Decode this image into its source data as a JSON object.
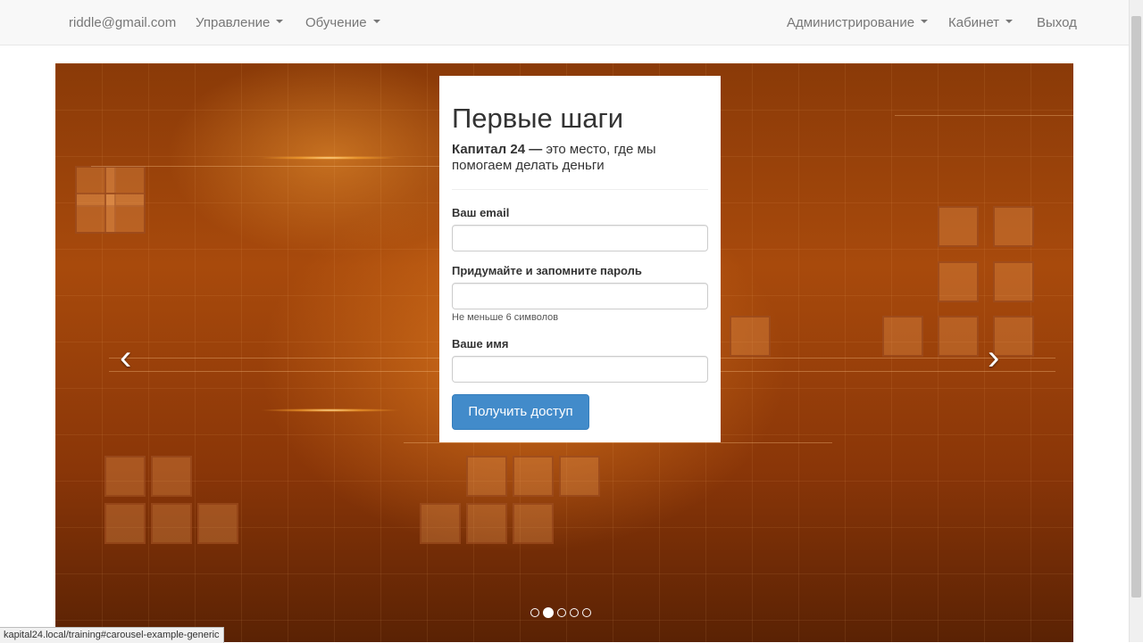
{
  "navbar": {
    "user_email": "riddle@gmail.com",
    "manage_label": "Управление",
    "training_label": "Обучение",
    "admin_label": "Администрирование",
    "cabinet_label": "Кабинет",
    "logout_label": "Выход"
  },
  "carousel": {
    "prev_icon": "‹",
    "next_icon": "›",
    "slide_count": 5,
    "active_slide": 2
  },
  "form": {
    "title": "Первые шаги",
    "lead_bold": "Капитал 24 —",
    "lead_rest": " это место, где мы помогаем делать деньги",
    "email_label": "Ваш email",
    "email_value": "",
    "password_label": "Придумайте и запомните пароль",
    "password_value": "",
    "password_help": "Не меньше 6 символов",
    "name_label": "Ваше имя",
    "name_value": "",
    "submit_label": "Получить доступ"
  },
  "statusbar": {
    "url": "kapital24.local/training#carousel-example-generic"
  },
  "colors": {
    "primary": "#428bca",
    "navbar_bg": "#f8f8f8",
    "nav_text": "#777777"
  }
}
